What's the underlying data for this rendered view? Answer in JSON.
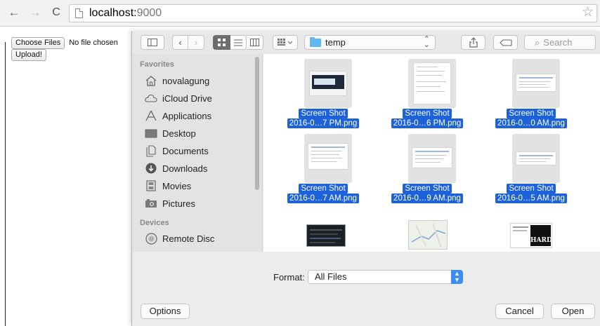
{
  "browser": {
    "url_host": "localhost:",
    "url_port": "9000",
    "back_glyph": "←",
    "forward_glyph": "→",
    "reload_glyph": "C",
    "star_glyph": "☆"
  },
  "page": {
    "choose_files_label": "Choose Files",
    "file_status": "No file chosen",
    "upload_label": "Upload!"
  },
  "dialog": {
    "toolbar": {
      "sidebar_icon": "sidebar-toggle-icon",
      "back_glyph": "‹",
      "forward_glyph": "›",
      "view_icons": [
        "icon-view-icon",
        "list-view-icon",
        "column-view-icon"
      ],
      "arrange_icon": "arrange-icon",
      "folder": "temp",
      "search_placeholder": "Search"
    },
    "sidebar": {
      "favorites_heading": "Favorites",
      "favorites": [
        {
          "label": "novalagung",
          "icon": "home-icon"
        },
        {
          "label": "iCloud Drive",
          "icon": "cloud-icon"
        },
        {
          "label": "Applications",
          "icon": "applications-icon"
        },
        {
          "label": "Desktop",
          "icon": "desktop-icon"
        },
        {
          "label": "Documents",
          "icon": "documents-icon"
        },
        {
          "label": "Downloads",
          "icon": "downloads-icon"
        },
        {
          "label": "Movies",
          "icon": "movies-icon"
        },
        {
          "label": "Pictures",
          "icon": "pictures-icon"
        }
      ],
      "devices_heading": "Devices",
      "devices": [
        {
          "label": "Remote Disc",
          "icon": "disc-icon"
        }
      ]
    },
    "files": [
      {
        "line1": "Screen Shot",
        "line2": "2016-0…7 PM.png"
      },
      {
        "line1": "Screen Shot",
        "line2": "2016-0…6 PM.png"
      },
      {
        "line1": "Screen Shot",
        "line2": "2016-0…0 AM.png"
      },
      {
        "line1": "Screen Shot",
        "line2": "2016-0…7 AM.png"
      },
      {
        "line1": "Screen Shot",
        "line2": "2016-0…9 AM.png"
      },
      {
        "line1": "Screen Shot",
        "line2": "2016-0…5 AM.png"
      }
    ],
    "partial_thumbs": [
      {
        "icon": "dark-screenshot-thumbnail"
      },
      {
        "icon": "map-thumbnail"
      },
      {
        "icon": "hard-document-thumbnail",
        "text": "HARD"
      }
    ],
    "format_label": "Format:",
    "format_value": "All Files",
    "options_label": "Options",
    "cancel_label": "Cancel",
    "open_label": "Open"
  },
  "colors": {
    "selection_blue": "#1d62d8",
    "folder_blue": "#5fb8f0",
    "stepper_blue": "#3c8df3"
  }
}
